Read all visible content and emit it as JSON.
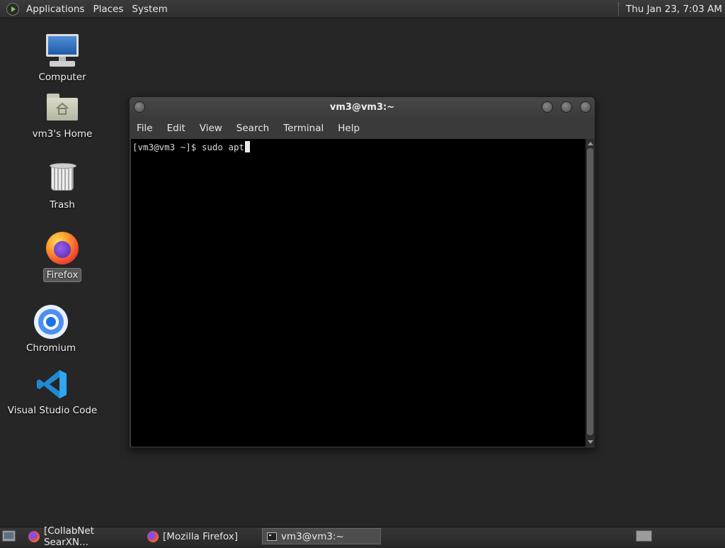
{
  "top_panel": {
    "menu": [
      "Applications",
      "Places",
      "System"
    ],
    "clock": "Thu Jan 23,  7:03 AM",
    "logo_icon": "app-menu-icon"
  },
  "desktop_icons": [
    {
      "label": "Computer",
      "icon": "computer-icon"
    },
    {
      "label": "vm3's Home",
      "icon": "home-folder-icon"
    },
    {
      "label": "Trash",
      "icon": "trash-icon"
    },
    {
      "label": "Firefox",
      "icon": "firefox-icon",
      "selected": true
    },
    {
      "label": "Chromium",
      "icon": "chromium-icon"
    },
    {
      "label": "Visual Studio Code",
      "icon": "vscode-icon"
    }
  ],
  "terminal": {
    "title": "vm3@vm3:~",
    "menu": [
      "File",
      "Edit",
      "View",
      "Search",
      "Terminal",
      "Help"
    ],
    "prompt": "[vm3@vm3 ~]$ ",
    "input": "sudo apt",
    "background": "#000000",
    "foreground": "#d8d8d8"
  },
  "taskbar": {
    "tasks": [
      {
        "label": "[CollabNet SearXN...",
        "icon": "firefox-icon",
        "active": false
      },
      {
        "label": "[Mozilla Firefox]",
        "icon": "firefox-icon",
        "active": false
      },
      {
        "label": "vm3@vm3:~",
        "icon": "terminal-icon",
        "active": true
      }
    ],
    "show_desktop_icon": "show-desktop-icon",
    "workspace_icon": "workspace-switcher-icon"
  },
  "colors": {
    "desktop_bg": "#262626",
    "panel_bg": "#333333",
    "accent_firefox": "#ff7139",
    "accent_vscode": "#23a9f2"
  }
}
